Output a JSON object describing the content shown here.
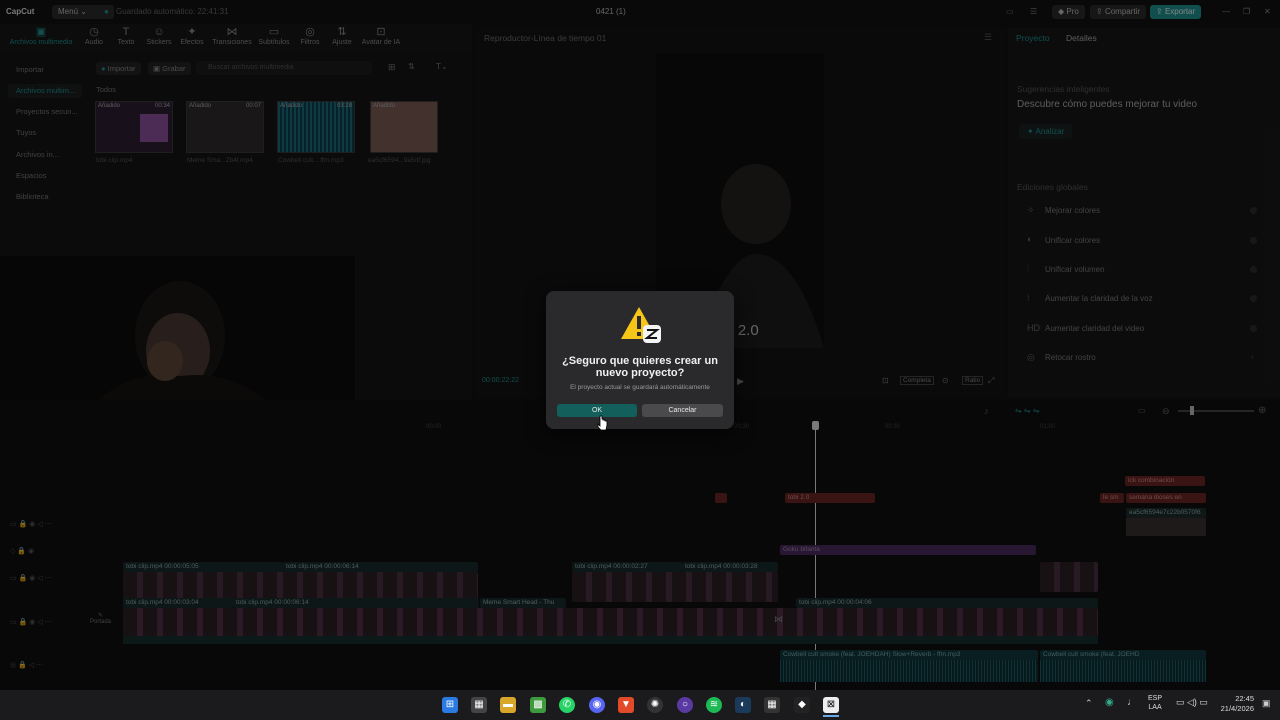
{
  "titlebar": {
    "app_name": "CapCut",
    "menu": "Menú",
    "autosave": "Guardado automático: 22:41:31",
    "project": "0421 (1)",
    "pro": "Pro",
    "share": "Compartir",
    "export": "Exportar"
  },
  "toolbar": {
    "tools": [
      "Archivos multimedia",
      "Audio",
      "Texto",
      "Stickers",
      "Efectos",
      "Transiciones",
      "Subtítulos",
      "Filtros",
      "Ajuste",
      "Avatar de IA"
    ]
  },
  "media": {
    "import_btn": "Importar",
    "record_btn": "Grabar",
    "search_placeholder": "Buscar archivos multimedia",
    "all_label": "Todos",
    "side": [
      "Importar",
      "Archivos multim...",
      "Proyectos secun...",
      "Tuyos",
      "Archivos in...",
      "Espacios",
      "Biblioteca"
    ],
    "items": [
      {
        "tag": "Añadido",
        "dur": "00:34",
        "name": "tobi clip.mp4"
      },
      {
        "tag": "Añadido",
        "dur": "00:07",
        "name": "Meme Sma...Zb4l.mp4"
      },
      {
        "tag": "Añadido",
        "dur": "03:28",
        "name": "Cowbell cult... ffm.mp3"
      },
      {
        "tag": "Añadido",
        "dur": "",
        "name": "ea5cf6594...9a5df.jpg"
      }
    ]
  },
  "player": {
    "title": "Reproductor-Línea de tiempo 01",
    "overlay_text": "bi 2.0",
    "timecode": "00:00:22:22",
    "completa": "Completa",
    "ratio": "Ratio"
  },
  "rightpanel": {
    "tab_project": "Proyecto",
    "tab_details": "Detalles",
    "smart_heading": "Sugerencias inteligentes",
    "smart_desc": "Descubre cómo puedes mejorar tu video",
    "analyze": "Analizar",
    "global_heading": "Ediciones globales",
    "items": [
      "Mejorar colores",
      "Unificar colores",
      "Unificar volumen",
      "Aumentar la claridad de la voz",
      "Aumentar claridad del video",
      "Retocar rostro"
    ]
  },
  "timeline": {
    "ruler": [
      "00:00",
      "00:30",
      "00:30",
      "01:00"
    ],
    "portada": "Portada",
    "text_clips": [
      "tobi 2.0",
      "Goku bifanta",
      "ick combinación",
      "semana dioses en",
      "ea5cf6594e7c22b0570f6",
      "le sm"
    ],
    "video_clips": [
      "tobi clip.mp4  00:00:05:05",
      "tobi clip.mp4  00:00:06:14",
      "tobi clip.mp4  00:00:02:27",
      "tobi clip.mp4  00:00:03:28",
      "tobi cl",
      "tobi clip.mp",
      "tobi clip.mp4  00:00:03:04",
      "tobi clip.mp4  00:00:06:14",
      "Meme Smart Head - Thu",
      "tobi clip.mp4  00:00:04:06"
    ],
    "audio_clip": "Cowbell cult smoke (feat. JOEHDAH) Slow+Reverb - ffm.mp3",
    "audio_clip2": "Cowbell cult smoke (feat. JOEHD"
  },
  "overlay": {
    "number": "3"
  },
  "dialog": {
    "title": "¿Seguro que quieres crear un nuevo proyecto?",
    "subtitle": "El proyecto actual se guardará automáticamente",
    "ok": "OK",
    "cancel": "Cancelar"
  },
  "taskbar": {
    "lang": "ESP",
    "lang2": "LAA",
    "time": "22:45",
    "date": "21/4/2026"
  },
  "colors": {
    "accent": "#1f8f8f",
    "ok_button": "#135f5b",
    "warning": "#f5c518",
    "text_clip": "#7a2a2a",
    "sticker_clip": "#5a3070"
  }
}
